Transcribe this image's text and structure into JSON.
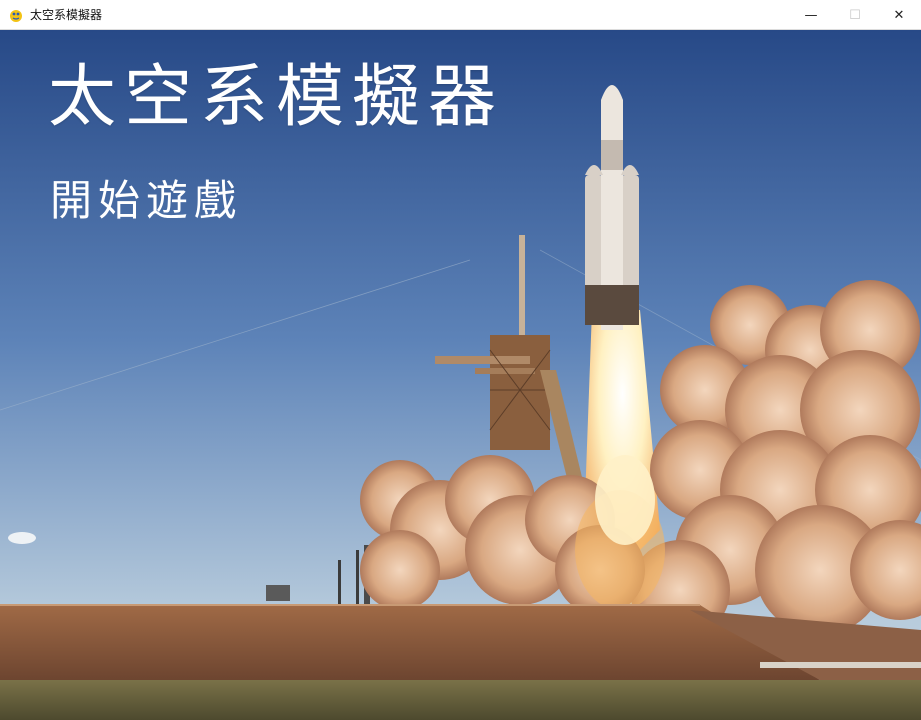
{
  "window": {
    "title": "太空系模擬器",
    "app_icon": "pygame-snake-icon",
    "controls": {
      "minimize": "—",
      "maximize": "☐",
      "close": "✕"
    }
  },
  "main_menu": {
    "title": "太空系模擬器",
    "start_label": "開始遊戲"
  },
  "colors": {
    "sky_top": "#2c4c8a",
    "sky_bottom": "#a9c0d6",
    "smoke": "#e6b99a",
    "flame": "#fff3c8",
    "ground": "#8a5a3a",
    "text": "#ffffff"
  }
}
